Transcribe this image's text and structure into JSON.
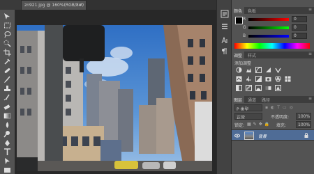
{
  "document": {
    "tab_title": "zn921.jpg @ 160%(RGB/8#)",
    "close_glyph": "×"
  },
  "toolbar": {
    "tools": [
      "move-tool",
      "marquee-tool",
      "lasso-tool",
      "quick-select-tool",
      "crop-tool",
      "eyedropper-tool",
      "healing-brush-tool",
      "brush-tool",
      "clone-stamp-tool",
      "history-brush-tool",
      "eraser-tool",
      "gradient-tool",
      "blur-tool",
      "dodge-tool",
      "pen-tool",
      "type-tool",
      "path-select-tool",
      "shape-tool",
      "hand-tool",
      "zoom-tool"
    ]
  },
  "color_panel": {
    "tabs": [
      "颜色",
      "色板"
    ],
    "menu": "≡",
    "channels": [
      {
        "label": "R",
        "value": "0"
      },
      {
        "label": "G",
        "value": "0"
      },
      {
        "label": "B",
        "value": "0"
      }
    ]
  },
  "adjustments_panel": {
    "tabs": [
      "调整",
      "样式"
    ],
    "menu": "≡",
    "title": "添加调整"
  },
  "layers_panel": {
    "tabs": [
      "图层",
      "通道",
      "路径"
    ],
    "menu": "≡",
    "filter": "P 类型",
    "blend_mode": "正常",
    "opacity_label": "不透明度:",
    "opacity_value": "100%",
    "lock_label": "锁定:",
    "fill_label": "填充:",
    "fill_value": "100%",
    "layer_name": "背景"
  },
  "colors": {
    "panel_bg": "#535353",
    "layer_selected": "#4f6c96"
  }
}
